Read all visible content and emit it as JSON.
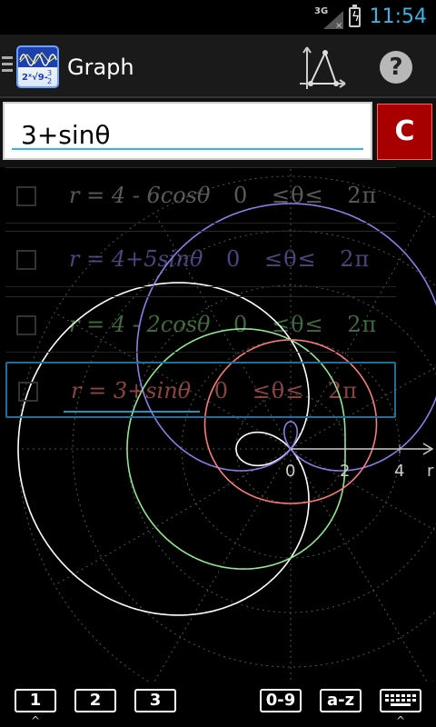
{
  "status_bar": {
    "network": "3G",
    "time": "11:54",
    "time_color": "#33b5e5"
  },
  "action_bar": {
    "title": "Graph",
    "icons": [
      "menu-icon",
      "app-logo",
      "triangle-graph-icon",
      "help-icon"
    ],
    "help_label": "?"
  },
  "input": {
    "value": "3+sinθ",
    "clear_label": "C",
    "clear_color": "#a80000"
  },
  "functions": [
    {
      "expression": "r = 4 - 6cosθ",
      "domain_start": "0",
      "domain_op": "≤θ≤",
      "domain_end": "2π",
      "color": "#ffffff",
      "checked": false
    },
    {
      "expression": "r = 4+5sinθ",
      "domain_start": "0",
      "domain_op": "≤θ≤",
      "domain_end": "2π",
      "color": "#8a7fe8",
      "checked": false
    },
    {
      "expression": "r = 4 - 2cosθ",
      "domain_start": "0",
      "domain_op": "≤θ≤",
      "domain_end": "2π",
      "color": "#8fe88f",
      "checked": false
    },
    {
      "expression": "r = 3+sinθ",
      "domain_start": "0",
      "domain_op": "≤θ≤",
      "domain_end": "2π",
      "color": "#ff7a7a",
      "checked": false,
      "selected": true
    }
  ],
  "graph": {
    "axis_tick_labels": [
      "0",
      "2",
      "4"
    ],
    "axis_name": "r",
    "curve_colors": [
      "#ffffff",
      "#8a7fe8",
      "#8fe88f",
      "#ff7a7a"
    ]
  },
  "bottom_bar": {
    "buttons": [
      "1",
      "2",
      "3",
      "0-9",
      "a-z"
    ],
    "keyboard_icon": "keyboard-icon"
  }
}
